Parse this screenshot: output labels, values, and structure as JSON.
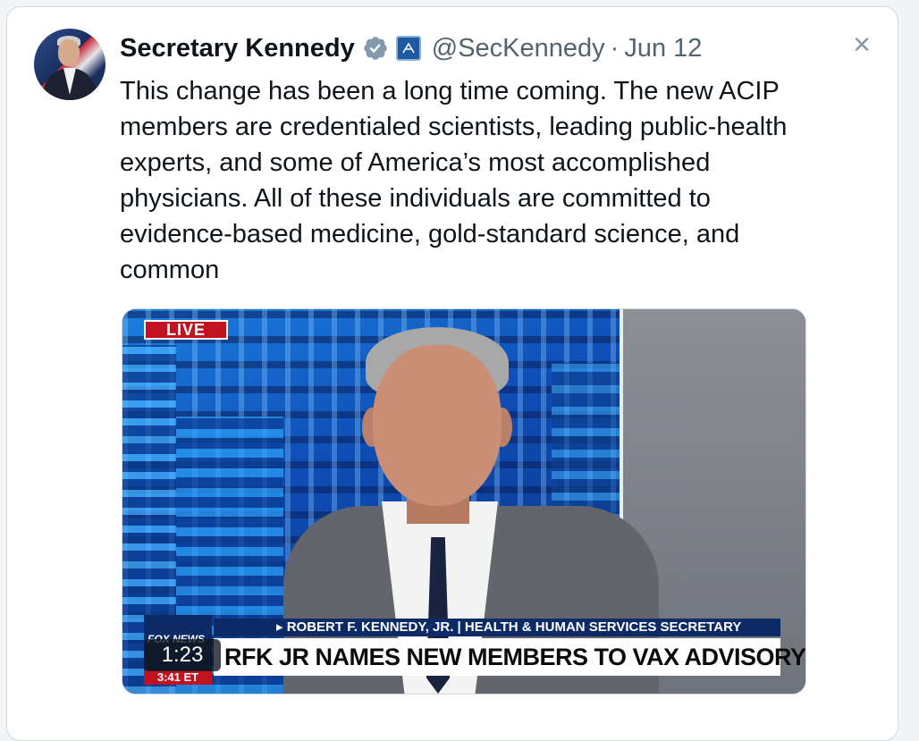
{
  "tweet": {
    "author_name": "Secretary Kennedy",
    "handle": "@SecKennedy",
    "separator": "·",
    "date": "Jun 12",
    "text": "This change has been a long time coming. The new ACIP members are credentialed scientists, leading public-health experts, and some of America’s most accomplished physicians. All of these individuals are committed to evidence-based medicine, gold-standard science, and common"
  },
  "media": {
    "live_badge": "LIVE",
    "channel_logo": "FOX NEWS",
    "broadcast_time": "3:41 ET",
    "strap_top": "▸ ROBERT F. KENNEDY, JR. | HEALTH & HUMAN SERVICES SECRETARY",
    "strap_headline": "RFK JR NAMES NEW MEMBERS TO VAX ADVISORY COMMITTEE",
    "duration": "1:23"
  },
  "icons": {
    "verified": "verified-badge-icon",
    "agency": "government-agency-icon",
    "close": "close-icon"
  },
  "colors": {
    "verified_badge": "#829aab",
    "text_primary": "#0f1419",
    "text_secondary": "#536471",
    "live_red": "#c1121f",
    "fox_blue": "#0b2a66"
  }
}
